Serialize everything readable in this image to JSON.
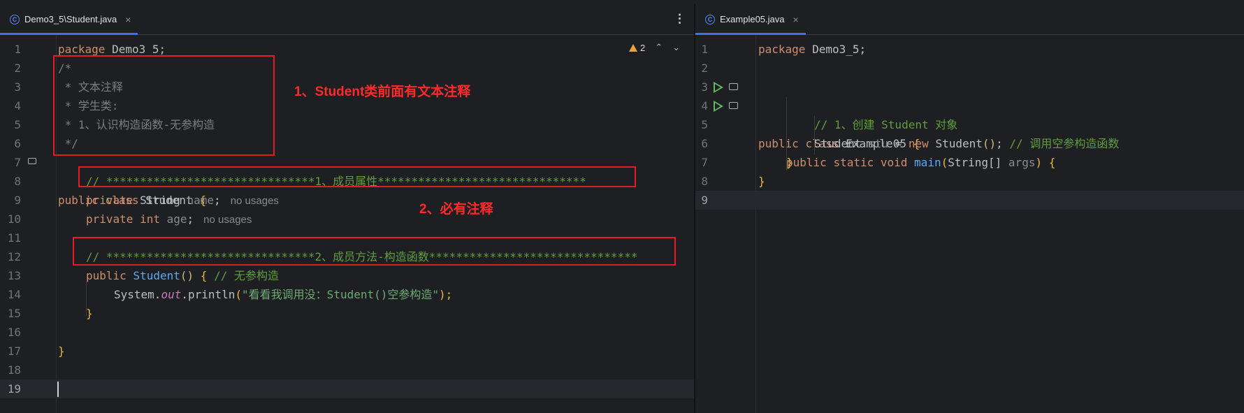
{
  "left_tab": {
    "label": "Demo3_5\\Student.java",
    "close": "×",
    "icon": "class-icon",
    "icon_glyph": "C"
  },
  "right_tab": {
    "label": "Example05.java",
    "close": "×",
    "icon": "class-icon",
    "icon_glyph": "C"
  },
  "menu_glyph": "⋮",
  "inspections": {
    "warning_count": "2",
    "up": "⌃",
    "down": "⌄"
  },
  "left_lines": [
    "1",
    "2",
    "3",
    "4",
    "5",
    "6",
    "7",
    "8",
    "9",
    "10",
    "11",
    "12",
    "13",
    "14",
    "15",
    "16",
    "17",
    "18",
    "19"
  ],
  "right_lines": [
    "1",
    "2",
    "3",
    "4",
    "5",
    "6",
    "7",
    "8",
    "9"
  ],
  "left_code": {
    "l1": {
      "kw": "package",
      "rest": " Demo3_5;"
    },
    "l2": "/*",
    "l3": " * 文本注释",
    "l4": " * 学生类:",
    "l5": " * 1、认识构造函数-无参构造",
    "l6": " */",
    "l7": {
      "kw1": "public",
      "kw2": "class",
      "name": "Student",
      "brace": "{"
    },
    "l8": "// *******************************1、成员属性*******************************",
    "l9": {
      "kw": "private",
      "type": "String",
      "name": "name",
      "semi": ";",
      "hint": "no usages"
    },
    "l10": {
      "kw": "private",
      "type": "int",
      "name": "age",
      "semi": ";",
      "hint": "no usages"
    },
    "l12": "// *******************************2、成员方法-构造函数*******************************",
    "l13": {
      "kw": "public",
      "name": "Student",
      "parens": "()",
      "brace": "{",
      "comment": "// 无参构造"
    },
    "l14": {
      "obj": "System.",
      "field": "out",
      "call": ".println",
      "open": "(",
      "str": "\"看看我调用没：Student()空参构造\"",
      "close": ");"
    },
    "l15": "}",
    "l17": "}"
  },
  "right_code": {
    "l1": {
      "kw": "package",
      "rest": " Demo3_5;"
    },
    "l3": {
      "kw1": "public",
      "kw2": "class",
      "name": "Example05",
      "brace": "{"
    },
    "l4": {
      "kw1": "public",
      "kw2": "static",
      "kw3": "void",
      "name": "main",
      "open": "(",
      "type": "String[]",
      "arg": "args",
      "close": ")",
      "brace": "{"
    },
    "l5": "// 1、创建 Student 对象",
    "l6": {
      "type": "Student",
      "var": "stu",
      "eq": " = ",
      "kw": "new",
      "ctor": "Student",
      "parens": "()",
      "semi": ";",
      "comment": "// 调用空参构造函数"
    },
    "l7": "}",
    "l8": "}"
  },
  "annotations": {
    "a1": "1、Student类前面有文本注释",
    "a2": "2、必有注释"
  },
  "colors": {
    "accent": "#3574f0",
    "annotation_red": "#e51c23",
    "run_green": "#5fb865"
  }
}
